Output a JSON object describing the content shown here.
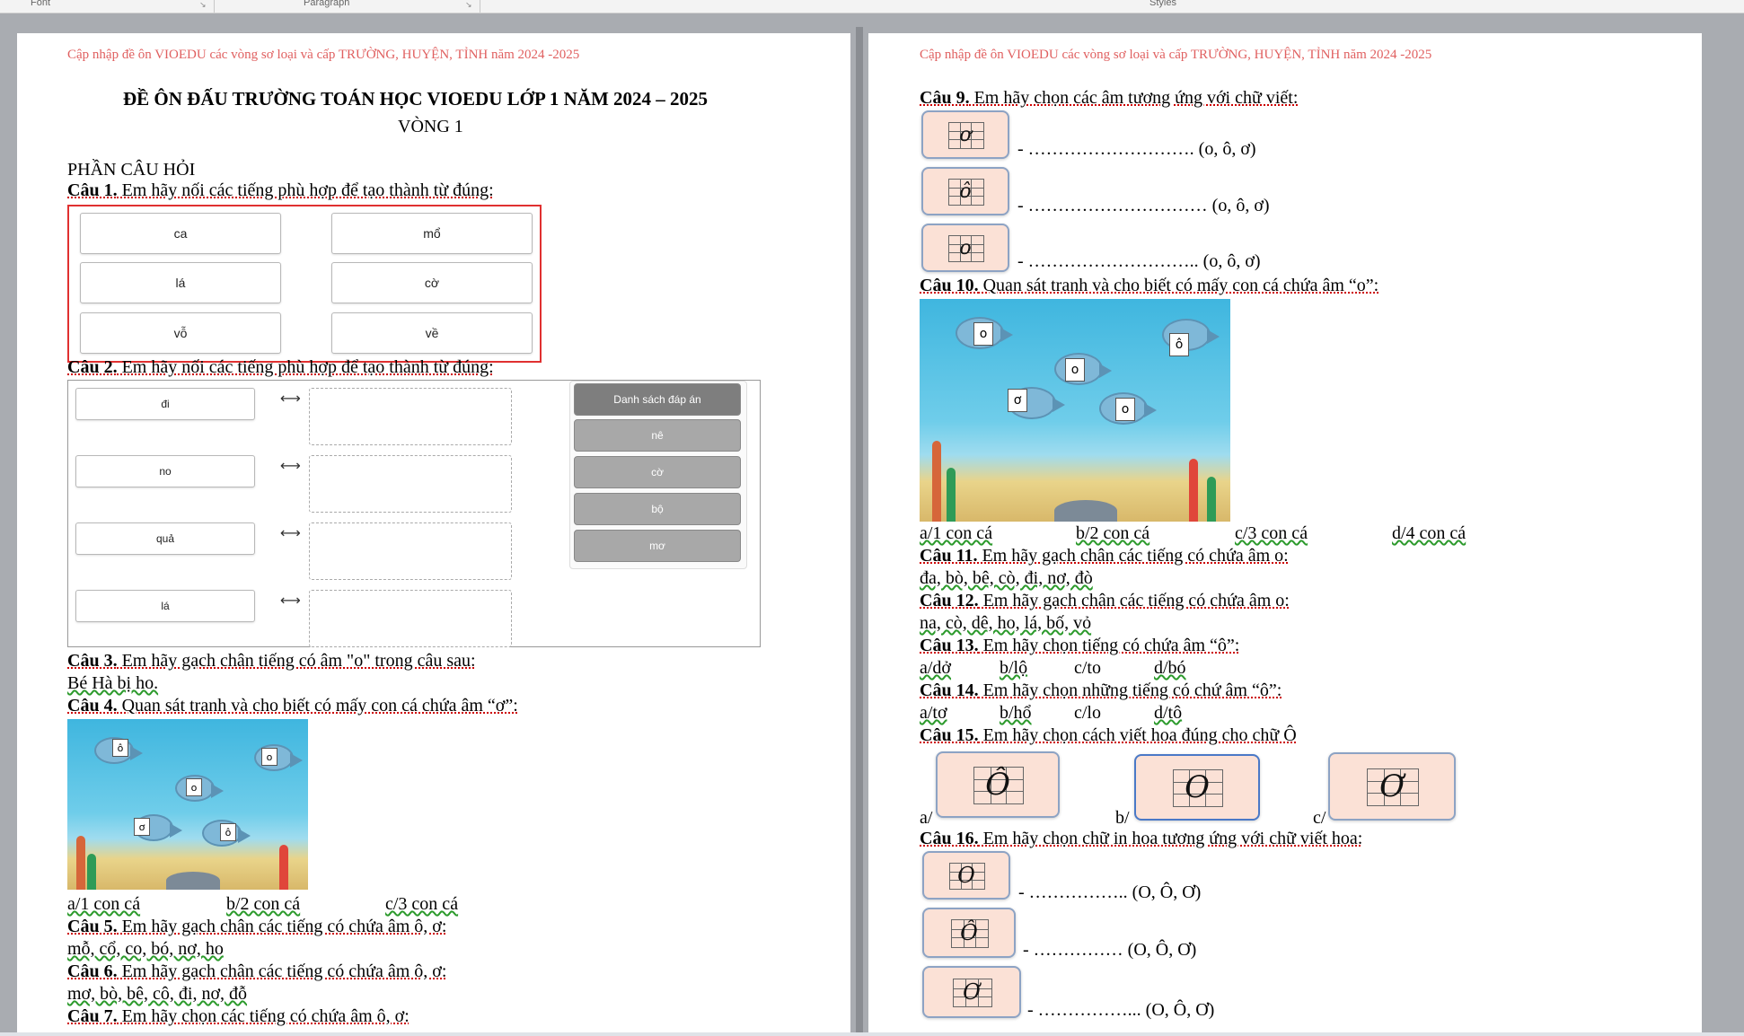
{
  "ribbon": {
    "font_label": "Font",
    "paragraph_label": "Paragraph",
    "styles_label": "Styles"
  },
  "header_text": "Cập nhập đề ôn VIOEDU  các vòng  sơ loại và cấp TRƯỜNG,  HUYỆN,  TỈNH năm 2024 -2025",
  "page1": {
    "title": "ĐỀ ÔN ĐẤU TRƯỜNG TOÁN HỌC VIOEDU LỚP 1 NĂM 2024 – 2025",
    "subtitle": "VÒNG 1",
    "section": "PHẦN CÂU HỎI",
    "q1": {
      "label": "Câu 1.",
      "text": " Em hãy nối các tiếng phù hợp để tạo thành từ đúng:",
      "left": [
        "ca",
        "lá",
        "vỗ"
      ],
      "right": [
        "mổ",
        "cờ",
        "về"
      ]
    },
    "q2": {
      "label": "Câu 2.",
      "text": " Em hãy nối các tiếng phù hợp để tạo thành từ đúng:",
      "left": [
        "đi",
        "no",
        "quả",
        "lá"
      ],
      "connector": "⟷",
      "answer_header": "Danh sách đáp án",
      "answers": [
        "nê",
        "cờ",
        "bộ",
        "mơ"
      ]
    },
    "q3": {
      "label": "Câu 3.",
      "text": " Em hãy gạch chân tiếng có âm \"o\" trong câu sau:",
      "sentence": "Bé Hà bị ho."
    },
    "q4": {
      "label": "Câu 4.",
      "text": " Quan sát tranh và cho biết có mấy con cá chứa âm “ơ”:",
      "cards": [
        "ô",
        "o",
        "o",
        "ơ",
        "ô"
      ],
      "options": [
        "a/1 con cá",
        "b/2 con cá",
        "c/3 con cá"
      ]
    },
    "q5": {
      "label": "Câu 5.",
      "text": " Em hãy gạch chân các tiếng có chứa âm ô, ơ:",
      "words": "mỗ, cổ, co, bó, nơ, ho"
    },
    "q6": {
      "label": "Câu 6.",
      "text": " Em hãy gạch chân các tiếng có chứa âm ô, ơ:",
      "words": "mơ, bò, bê, cô, đi, nơ, đỗ"
    },
    "q7": {
      "label": "Câu 7.",
      "text": " Em hãy chọn các tiếng có chứa âm ô, ơ:"
    }
  },
  "page2": {
    "q9": {
      "label": "Câu 9.",
      "text": " Em hãy chọn các âm tương ứng với chữ viết:",
      "letters": [
        "ơ",
        "ô",
        "o"
      ],
      "blanks": [
        "- ………………………. (o, ô, ơ)",
        "- ………………………… (o, ô, ơ)",
        "- ……………………….. (o, ô, ơ)"
      ]
    },
    "q10": {
      "label": "Câu 10.",
      "text": " Quan sát tranh và cho biết có mấy con cá chứa âm “o”:",
      "cards": [
        "o",
        "ô",
        "o",
        "ơ",
        "o"
      ],
      "options": [
        "a/1 con cá",
        "b/2 con cá",
        "c/3 con cá",
        "d/4 con cá"
      ]
    },
    "q11": {
      "label": "Câu 11.",
      "text": " Em hãy gạch chân các tiếng có chứa âm o:",
      "words": "đa, bò, bê, cò, đi, nơ, đò"
    },
    "q12": {
      "label": "Câu 12.",
      "text": " Em hãy gạch chân các tiếng có chứa âm o:",
      "words": "na, cò, dê, ho, lá, bố, vỏ"
    },
    "q13": {
      "label": "Câu 13.",
      "text": " Em hãy chọn tiếng có chứa âm “ô”:",
      "options": [
        "a/dở",
        "b/lộ",
        "c/to",
        "d/bó"
      ]
    },
    "q14": {
      "label": "Câu 14.",
      "text": " Em hãy chọn những tiếng có chứ âm “ô”:",
      "options": [
        "a/tơ",
        "b/hổ",
        "c/lo",
        "d/tô"
      ]
    },
    "q15": {
      "label": "Câu 15.",
      "text": " Em hãy chọn cách viết hoa đúng cho chữ Ô",
      "prefixes": [
        "a/",
        "b/",
        "c/"
      ],
      "letters": [
        "Ô",
        "O",
        "Ơ"
      ]
    },
    "q16": {
      "label": "Câu 16.",
      "text": " Em hãy chọn chữ in hoa tương ứng với chữ viết hoa:",
      "letters": [
        "O",
        "Ô",
        "Ơ"
      ],
      "blanks": [
        "- …………….. (O, Ô, Ơ)",
        "- …………… (O, Ô, Ơ)",
        "- ……………... (O, Ô, Ơ)"
      ]
    }
  }
}
